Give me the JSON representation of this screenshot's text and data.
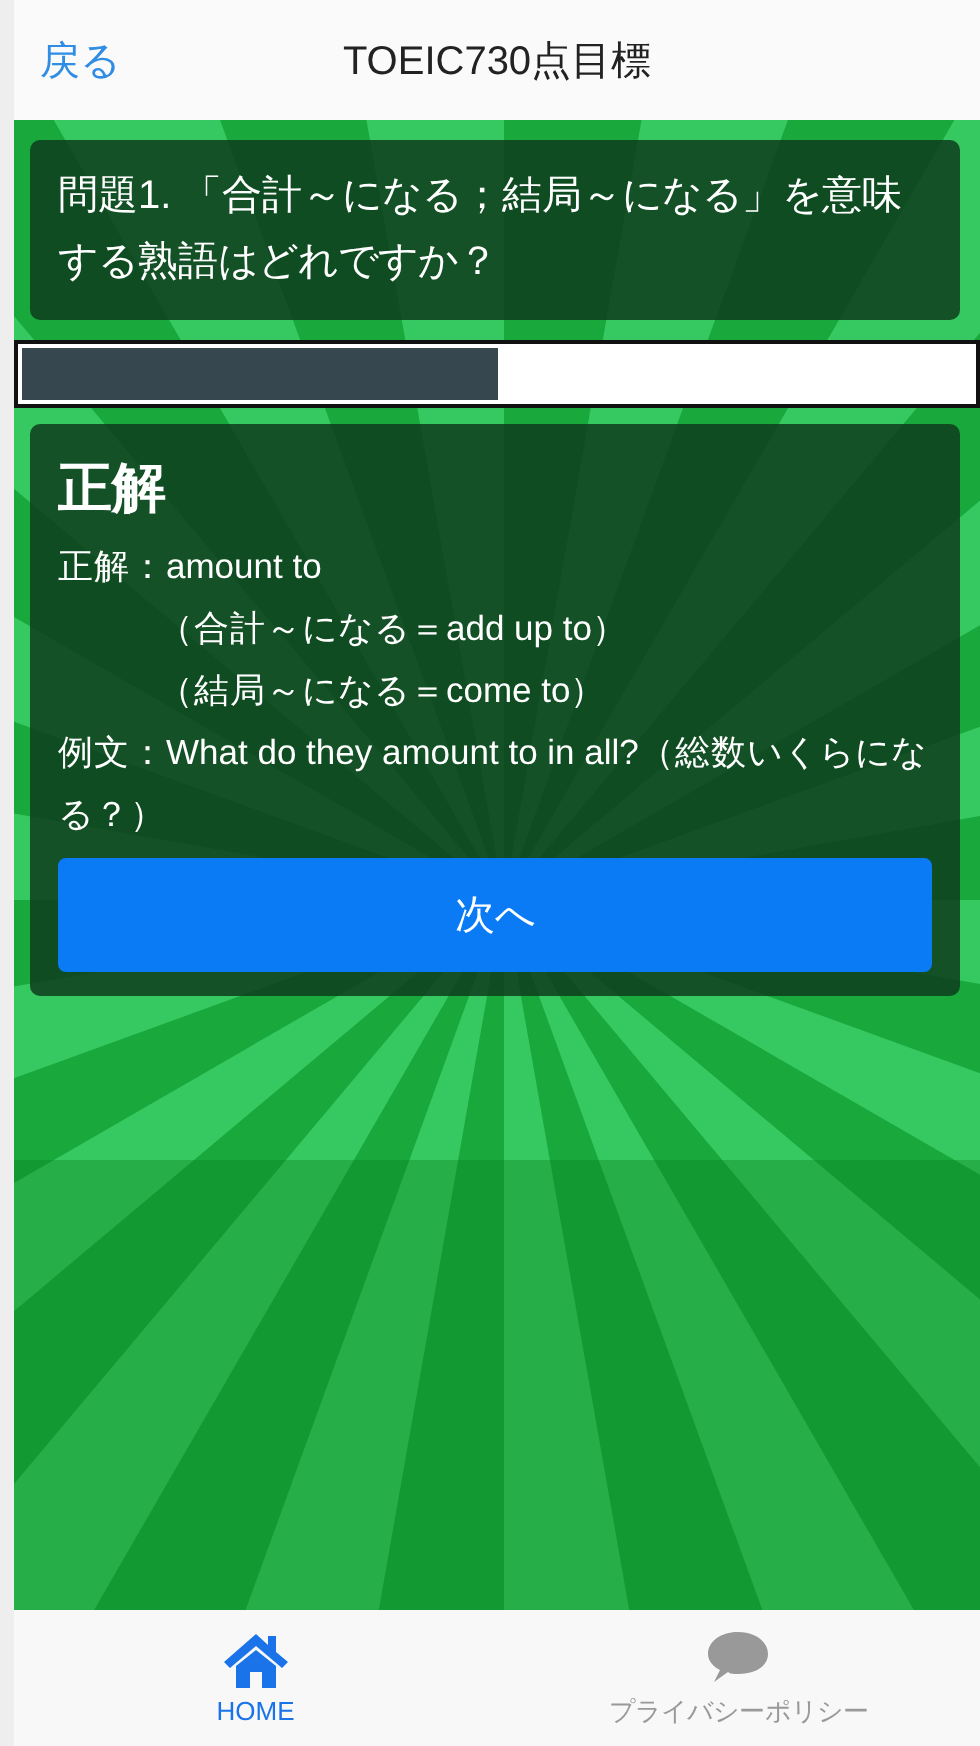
{
  "header": {
    "back": "戻る",
    "title": "TOEIC730点目標"
  },
  "question": "問題1. 「合計～になる；結局～になる」を意味する熟語はどれですか？",
  "progress": {
    "level": 0.5
  },
  "answer": {
    "heading": "正解",
    "lines": [
      {
        "text": "正解：amount to",
        "indented": false
      },
      {
        "text": "（合計～になる＝add up to）",
        "indented": true
      },
      {
        "text": "（結局～になる＝come to）",
        "indented": true
      },
      {
        "text": "例文：What do they amount to in all?（総数いくらになる？）",
        "indented": false
      }
    ],
    "button": "次へ"
  },
  "tabs": [
    {
      "label": "HOME",
      "kind": "home",
      "selected": true
    },
    {
      "label": "プライバシーポリシー",
      "kind": "chat",
      "selected": false
    }
  ]
}
